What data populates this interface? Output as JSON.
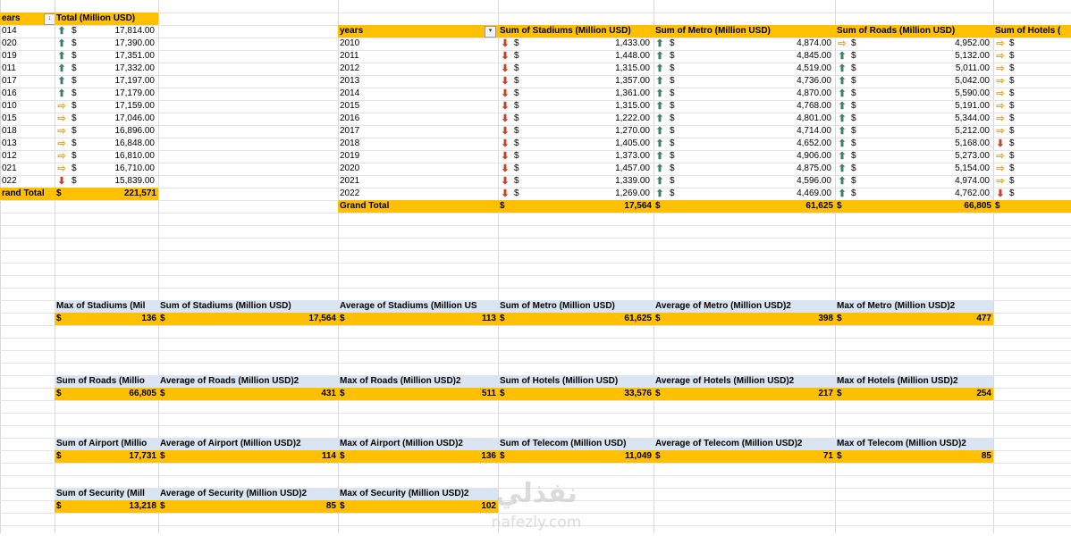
{
  "colors": {
    "header_fill": "#ffc000",
    "label_fill": "#dbe5f1",
    "arrow_up": "#3c7f6b",
    "arrow_side": "#f0a030",
    "arrow_down": "#c0452a"
  },
  "pivot1": {
    "col_years": "ears",
    "col_total": "Total (Million USD)",
    "currency": "$",
    "rows": [
      {
        "year": "014",
        "arrow": "up",
        "value": "17,814.00"
      },
      {
        "year": "020",
        "arrow": "up",
        "value": "17,390.00"
      },
      {
        "year": "019",
        "arrow": "up",
        "value": "17,351.00"
      },
      {
        "year": "011",
        "arrow": "up",
        "value": "17,332.00"
      },
      {
        "year": "017",
        "arrow": "up",
        "value": "17,197.00"
      },
      {
        "year": "016",
        "arrow": "up",
        "value": "17,179.00"
      },
      {
        "year": "010",
        "arrow": "side",
        "value": "17,159.00"
      },
      {
        "year": "015",
        "arrow": "side",
        "value": "17,046.00"
      },
      {
        "year": "018",
        "arrow": "side",
        "value": "16,896.00"
      },
      {
        "year": "013",
        "arrow": "side",
        "value": "16,848.00"
      },
      {
        "year": "012",
        "arrow": "side",
        "value": "16,810.00"
      },
      {
        "year": "021",
        "arrow": "side",
        "value": "16,710.00"
      },
      {
        "year": "022",
        "arrow": "down",
        "value": "15,839.00"
      }
    ],
    "grand_label": "rand Total",
    "grand_value": "221,571"
  },
  "pivot2": {
    "headers": [
      "years",
      "Sum of Stadiums (Million USD)",
      "Sum of Metro (Million USD)",
      "Sum of Roads (Million USD)",
      "Sum of Hotels ("
    ],
    "currency": "$",
    "rows": [
      {
        "year": "2010",
        "stadiums": "1,433.00",
        "sa": "down",
        "metro": "4,874.00",
        "ma": "up",
        "roads": "4,952.00",
        "ra": "side",
        "ha": "side"
      },
      {
        "year": "2011",
        "stadiums": "1,448.00",
        "sa": "down",
        "metro": "4,845.00",
        "ma": "up",
        "roads": "5,132.00",
        "ra": "up",
        "ha": "side"
      },
      {
        "year": "2012",
        "stadiums": "1,315.00",
        "sa": "down",
        "metro": "4,519.00",
        "ma": "up",
        "roads": "5,011.00",
        "ra": "up",
        "ha": "side"
      },
      {
        "year": "2013",
        "stadiums": "1,357.00",
        "sa": "down",
        "metro": "4,736.00",
        "ma": "up",
        "roads": "5,042.00",
        "ra": "up",
        "ha": "side"
      },
      {
        "year": "2014",
        "stadiums": "1,361.00",
        "sa": "down",
        "metro": "4,870.00",
        "ma": "up",
        "roads": "5,590.00",
        "ra": "up",
        "ha": "side"
      },
      {
        "year": "2015",
        "stadiums": "1,315.00",
        "sa": "down",
        "metro": "4,768.00",
        "ma": "up",
        "roads": "5,191.00",
        "ra": "up",
        "ha": "side"
      },
      {
        "year": "2016",
        "stadiums": "1,222.00",
        "sa": "down",
        "metro": "4,801.00",
        "ma": "up",
        "roads": "5,344.00",
        "ra": "up",
        "ha": "side"
      },
      {
        "year": "2017",
        "stadiums": "1,270.00",
        "sa": "down",
        "metro": "4,714.00",
        "ma": "up",
        "roads": "5,212.00",
        "ra": "up",
        "ha": "side"
      },
      {
        "year": "2018",
        "stadiums": "1,405.00",
        "sa": "down",
        "metro": "4,652.00",
        "ma": "up",
        "roads": "5,168.00",
        "ra": "up",
        "ha": "down"
      },
      {
        "year": "2019",
        "stadiums": "1,373.00",
        "sa": "down",
        "metro": "4,906.00",
        "ma": "up",
        "roads": "5,273.00",
        "ra": "up",
        "ha": "side"
      },
      {
        "year": "2020",
        "stadiums": "1,457.00",
        "sa": "down",
        "metro": "4,875.00",
        "ma": "up",
        "roads": "5,154.00",
        "ra": "up",
        "ha": "side"
      },
      {
        "year": "2021",
        "stadiums": "1,339.00",
        "sa": "down",
        "metro": "4,596.00",
        "ma": "up",
        "roads": "4,974.00",
        "ra": "up",
        "ha": "side"
      },
      {
        "year": "2022",
        "stadiums": "1,269.00",
        "sa": "down",
        "metro": "4,469.00",
        "ma": "up",
        "roads": "4,762.00",
        "ra": "up",
        "ha": "down"
      }
    ],
    "grand_label": "Grand Total",
    "grand_stadiums": "17,564",
    "grand_metro": "61,625",
    "grand_roads": "66,805"
  },
  "summaries": [
    {
      "labels": [
        "Max of Stadiums (Mil",
        "Sum of Stadiums (Million USD)",
        "Average of Stadiums (Million US",
        "Sum of Metro (Million USD)",
        "Average of Metro (Million USD)2",
        "Max of Metro (Million USD)2"
      ],
      "values": [
        "136",
        "17,564",
        "113",
        "61,625",
        "398",
        "477"
      ]
    },
    {
      "labels": [
        "Sum of Roads (Millio",
        "Average of Roads (Million USD)2",
        "Max of Roads (Million USD)2",
        "Sum of Hotels (Million USD)",
        "Average of Hotels (Million USD)2",
        "Max of Hotels (Million USD)2"
      ],
      "values": [
        "66,805",
        "431",
        "511",
        "33,576",
        "217",
        "254"
      ]
    },
    {
      "labels": [
        "Sum of Airport (Millio",
        "Average of Airport (Million USD)2",
        "Max of Airport (Million USD)2",
        "Sum of Telecom (Million USD)",
        "Average of Telecom (Million USD)2",
        "Max of Telecom (Million USD)2"
      ],
      "values": [
        "17,731",
        "114",
        "136",
        "11,049",
        "71",
        "85"
      ]
    },
    {
      "labels": [
        "Sum of Security (Mill",
        "Average of Security (Million USD)2",
        "Max of Security (Million USD)2"
      ],
      "values": [
        "13,218",
        "85",
        "102"
      ]
    }
  ],
  "watermark": {
    "arabic": "نفذلي",
    "latin": "nafezly.com"
  }
}
